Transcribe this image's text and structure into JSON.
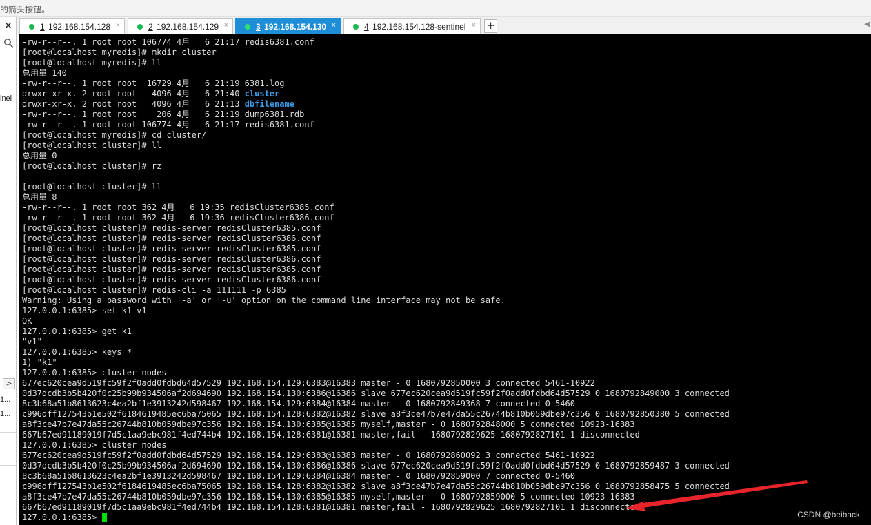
{
  "top_notice": "的箭头按钮。",
  "sidebar": {
    "close_glyph": "✕",
    "partial_label": "inel",
    "expand_glyph": ">",
    "item_1": "1...",
    "item_2": "1..."
  },
  "tabs": [
    {
      "num": "1",
      "label": " 192.168.154.128",
      "active": false
    },
    {
      "num": "2",
      "label": " 192.168.154.129",
      "active": false
    },
    {
      "num": "3",
      "label": " 192.168.154.130",
      "active": true
    },
    {
      "num": "4",
      "label": " 192.168.154.128-sentinel",
      "active": false
    }
  ],
  "tab_close_glyph": "×",
  "add_tab_label": "+",
  "terminal": {
    "lines": [
      "-rw-r--r--. 1 root root 106774 4月   6 21:17 redis6381.conf",
      "[root@localhost myredis]# mkdir cluster",
      "[root@localhost myredis]# ll",
      "总用量 140",
      "-rw-r--r--. 1 root root  16729 4月   6 21:19 6381.log",
      "drwxr-xr-x. 2 root root   4096 4月   6 21:40 ",
      "drwxr-xr-x. 2 root root   4096 4月   6 21:13 ",
      "-rw-r--r--. 1 root root    206 4月   6 21:19 dump6381.rdb",
      "-rw-r--r--. 1 root root 106774 4月   6 21:17 redis6381.conf",
      "[root@localhost myredis]# cd cluster/",
      "[root@localhost cluster]# ll",
      "总用量 0",
      "[root@localhost cluster]# rz",
      "",
      "[root@localhost cluster]# ll",
      "总用量 8",
      "-rw-r--r--. 1 root root 362 4月   6 19:35 redisCluster6385.conf",
      "-rw-r--r--. 1 root root 362 4月   6 19:36 redisCluster6386.conf",
      "[root@localhost cluster]# redis-server redisCluster6385.conf",
      "[root@localhost cluster]# redis-server redisCluster6386.conf",
      "[root@localhost cluster]# redis-server redisCluster6385.conf",
      "[root@localhost cluster]# redis-server redisCluster6386.conf",
      "[root@localhost cluster]# redis-server redisCluster6385.conf",
      "[root@localhost cluster]# redis-server redisCluster6386.conf",
      "[root@localhost cluster]# redis-cli -a 111111 -p 6385",
      "Warning: Using a password with '-a' or '-u' option on the command line interface may not be safe.",
      "127.0.0.1:6385> set k1 v1",
      "OK",
      "127.0.0.1:6385> get k1",
      "\"v1\"",
      "127.0.0.1:6385> keys *",
      "1) \"k1\"",
      "127.0.0.1:6385> cluster nodes",
      "677ec620cea9d519fc59f2f0add0fdbd64d57529 192.168.154.129:6383@16383 master - 0 1680792850000 3 connected 5461-10922",
      "0d37dcdb3b5b420f0c25b99b934506af2d694690 192.168.154.130:6386@16386 slave 677ec620cea9d519fc59f2f0add0fdbd64d57529 0 1680792849000 3 connected",
      "8c3b68a51b8613623c4ea2bf1e3913242d598467 192.168.154.129:6384@16384 master - 0 1680792849368 7 connected 0-5460",
      "c996dff127543b1e502f6184619485ec6ba75065 192.168.154.128:6382@16382 slave a8f3ce47b7e47da55c26744b810b059dbe97c356 0 1680792850380 5 connected",
      "a8f3ce47b7e47da55c26744b810b059dbe97c356 192.168.154.130:6385@16385 myself,master - 0 1680792848000 5 connected 10923-16383",
      "667b67ed91189019f7d5c1aa9ebc981f4ed744b4 192.168.154.128:6381@16381 master,fail - 1680792829625 1680792827101 1 disconnected",
      "127.0.0.1:6385> cluster nodes",
      "677ec620cea9d519fc59f2f0add0fdbd64d57529 192.168.154.129:6383@16383 master - 0 1680792860092 3 connected 5461-10922",
      "0d37dcdb3b5b420f0c25b99b934506af2d694690 192.168.154.130:6386@16386 slave 677ec620cea9d519fc59f2f0add0fdbd64d57529 0 1680792859487 3 connected",
      "8c3b68a51b8613623c4ea2bf1e3913242d598467 192.168.154.129:6384@16384 master - 0 1680792859000 7 connected 0-5460",
      "c996dff127543b1e502f6184619485ec6ba75065 192.168.154.128:6382@16382 slave a8f3ce47b7e47da55c26744b810b059dbe97c356 0 1680792858475 5 connected",
      "a8f3ce47b7e47da55c26744b810b059dbe97c356 192.168.154.130:6385@16385 myself,master - 0 1680792859000 5 connected 10923-16383",
      "667b67ed91189019f7d5c1aa9ebc981f4ed744b4 192.168.154.128:6381@16381 master,fail - 1680792829625 1680792827101 1 disconnected",
      "127.0.0.1:6385> "
    ],
    "dir_names": [
      "cluster",
      "dbfilename"
    ]
  },
  "watermark": "CSDN @beiback",
  "colors": {
    "terminal_bg": "#000000",
    "terminal_fg": "#dcdcdc",
    "directory": "#3d9ce8",
    "active_tab": "#1e8fd6",
    "status_dot": "#1db954",
    "cursor": "#00e000",
    "annotation_arrow": "#e8242b"
  }
}
